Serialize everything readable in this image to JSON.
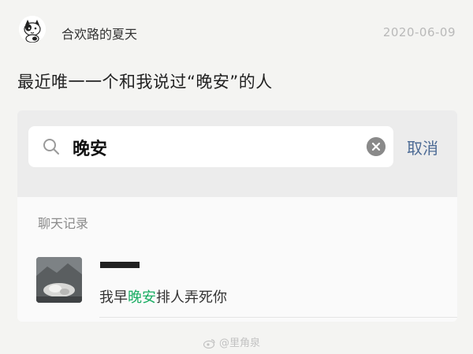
{
  "post": {
    "username": "合欢路的夏天",
    "date": "2020-06-09",
    "text": "最近唯一一个和我说过“晚安”的人"
  },
  "search": {
    "query": "晚安",
    "cancel_label": "取消"
  },
  "results": {
    "section_label": "聊天记录",
    "items": [
      {
        "message_prefix": "我早",
        "message_match": "晚安",
        "message_suffix": "排人弄死你"
      }
    ]
  },
  "watermark": {
    "text": "@里角泉"
  },
  "colors": {
    "match_highlight": "#1aad63",
    "cancel_text": "#4d6b95"
  }
}
